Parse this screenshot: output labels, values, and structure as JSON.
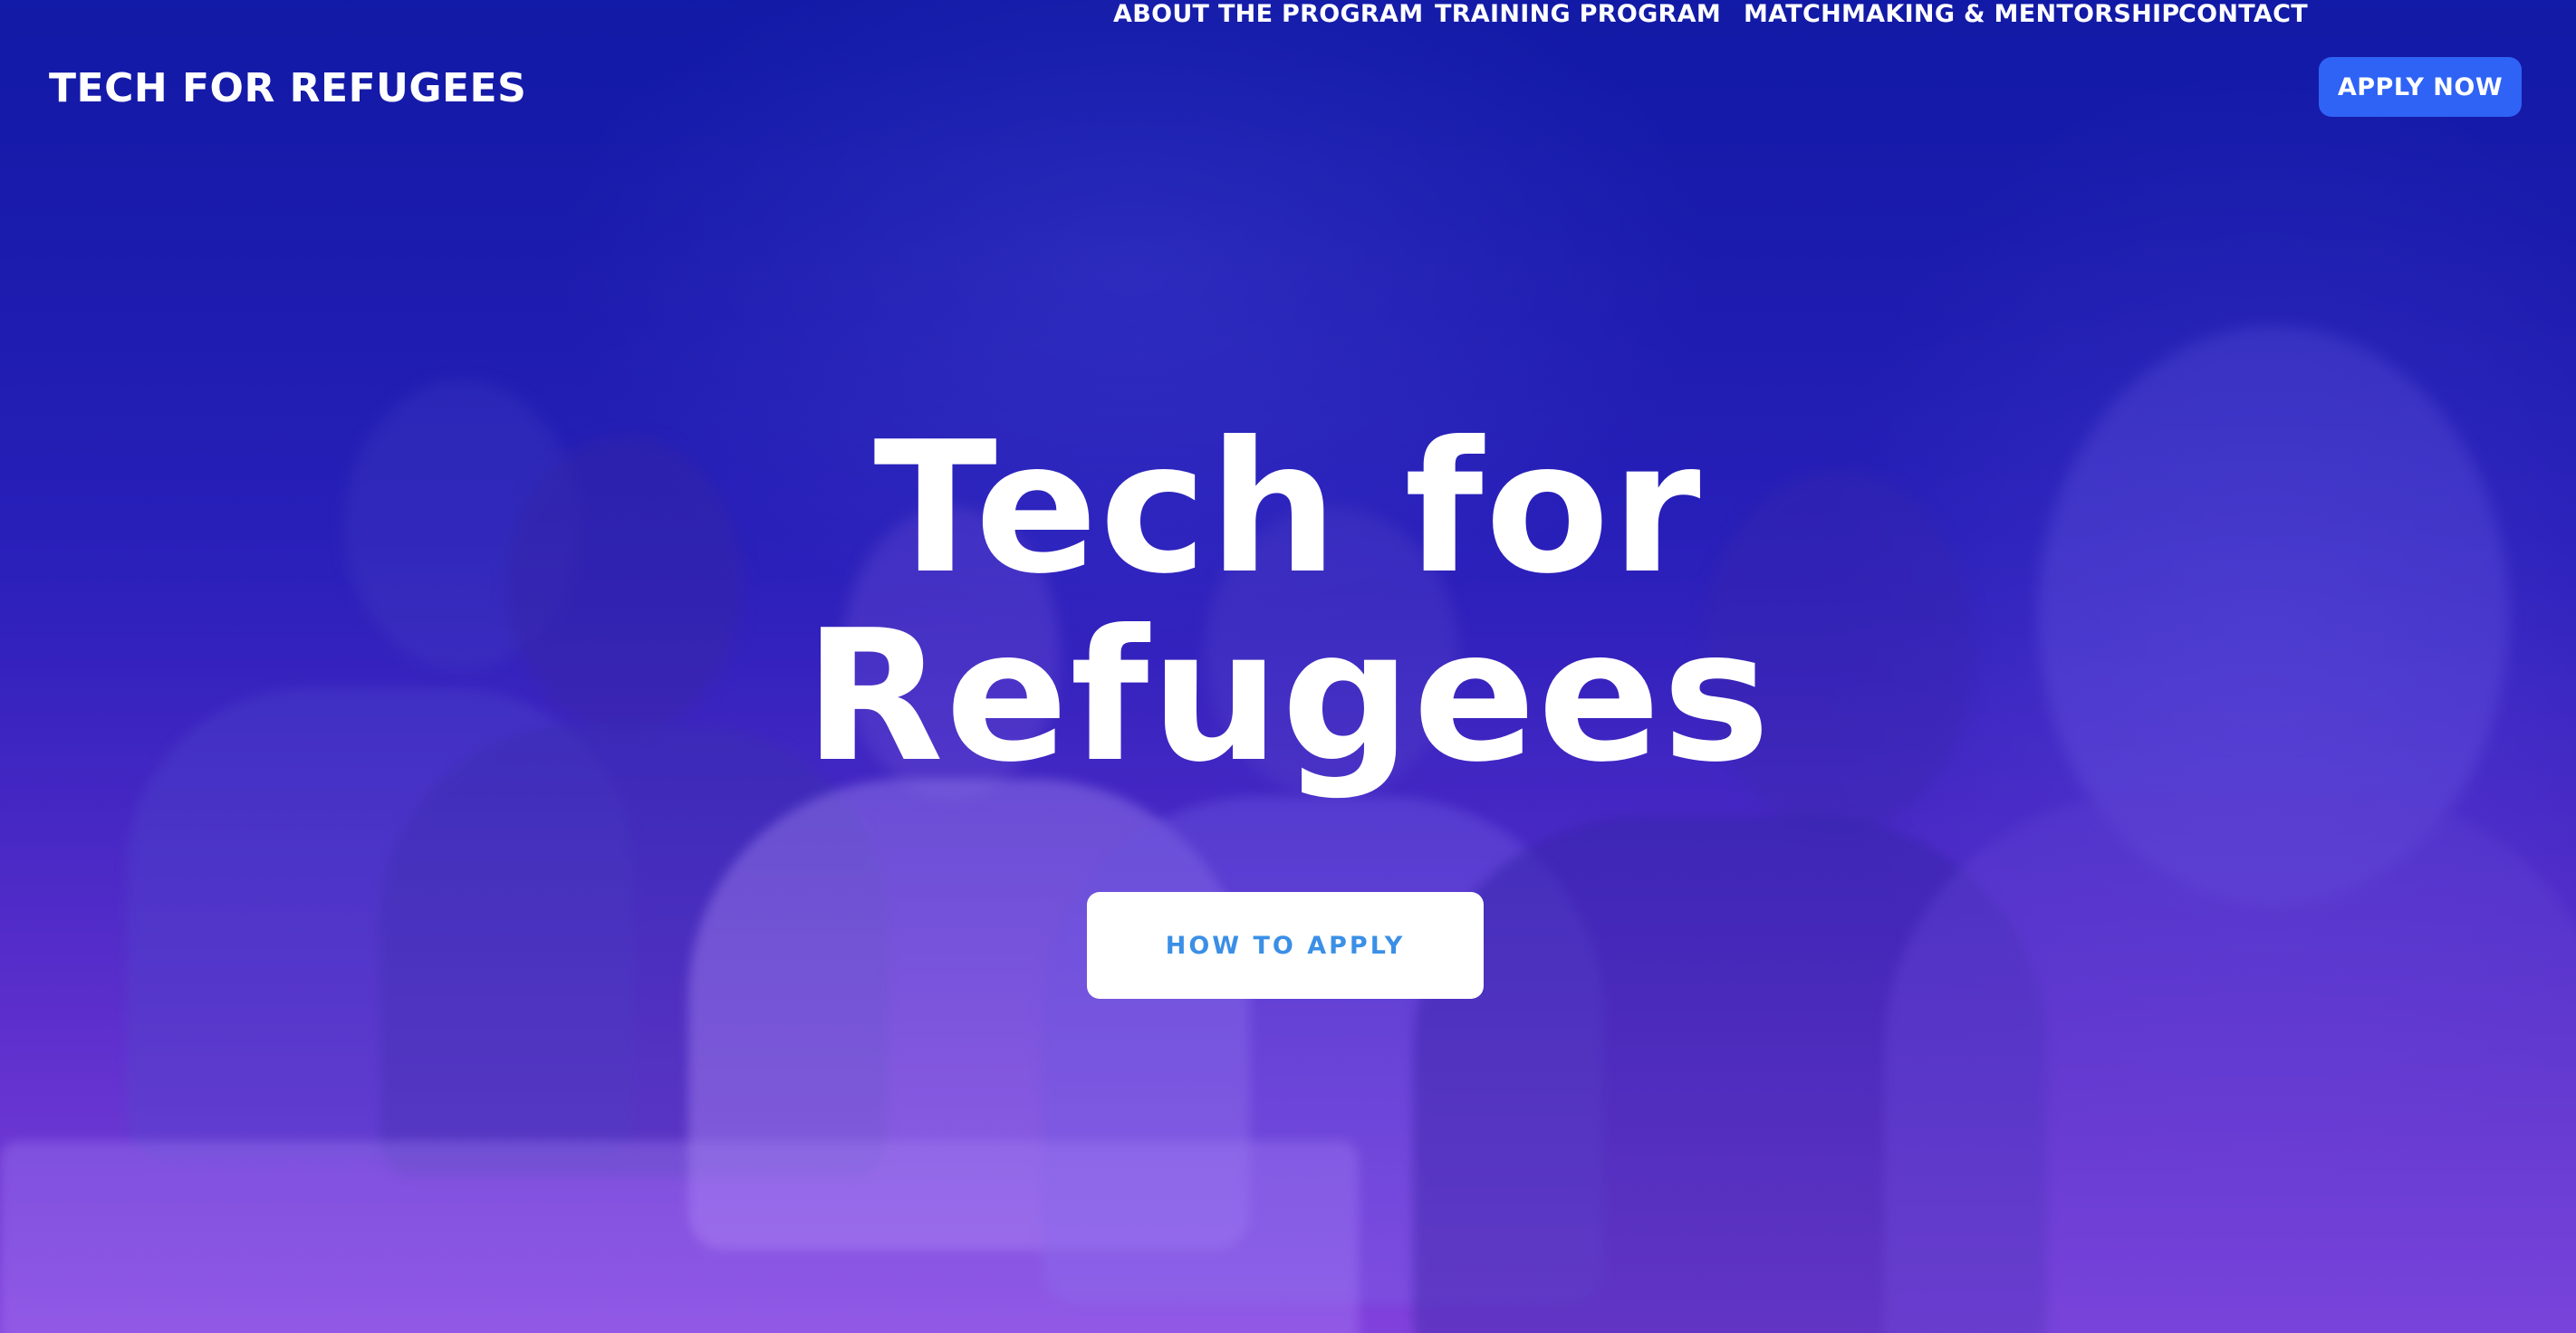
{
  "header": {
    "brand": "TECH FOR REFUGEES",
    "nav": [
      {
        "label": "ABOUT THE PROGRAM"
      },
      {
        "label": "TRAINING PROGRAM"
      },
      {
        "label": "MATCHMAKING & MENTORSHIP"
      },
      {
        "label": "CONTACT"
      }
    ],
    "cta_label": "APPLY NOW"
  },
  "hero": {
    "title_line1": "Tech for",
    "title_line2": "Refugees",
    "button_label": "HOW TO APPLY"
  },
  "colors": {
    "overlay_top": "#0a19aa",
    "overlay_bottom": "#8c46e6",
    "cta_background": "#2f63f5",
    "secondary_button_text": "#3b8fe6"
  }
}
